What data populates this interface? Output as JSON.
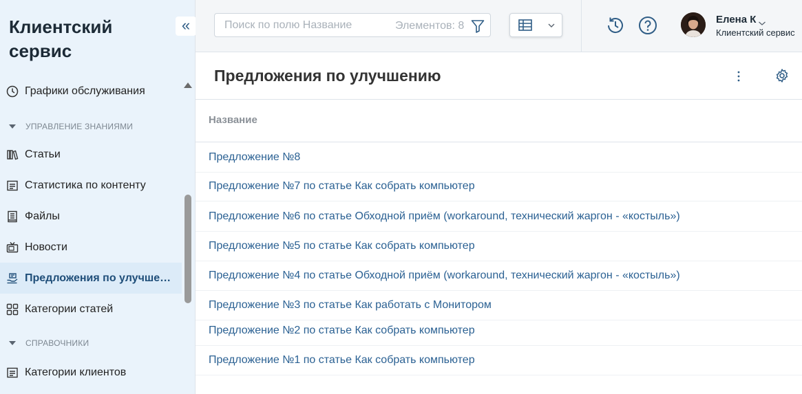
{
  "sidebar": {
    "app_title": "Клиентский сервис",
    "collapse_glyph": "«",
    "items": [
      {
        "label": "Графики обслуживания",
        "icon": "clock-icon"
      },
      {
        "label": "Статьи",
        "icon": "books-icon"
      },
      {
        "label": "Статистика по контенту",
        "icon": "list-icon"
      },
      {
        "label": "Файлы",
        "icon": "document-icon"
      },
      {
        "label": "Новости",
        "icon": "tv-icon"
      },
      {
        "label": "Предложения по улучшен...",
        "icon": "hand-icon",
        "active": true
      },
      {
        "label": "Категории статей",
        "icon": "grid-icon"
      },
      {
        "label": "Категории клиентов",
        "icon": "list-icon"
      }
    ],
    "sections": [
      {
        "label": "УПРАВЛЕНИЕ ЗНАНИЯМИ"
      },
      {
        "label": "СПРАВОЧНИКИ"
      }
    ]
  },
  "header": {
    "search_placeholder": "Поиск по полю Название",
    "search_count": "Элементов: 8",
    "user_name": "Елена К",
    "user_role": "Клиентский сервис"
  },
  "main": {
    "title": "Предложения по улучшению",
    "column_header": "Название",
    "rows": [
      "Предложение №8",
      "Предложение №7  по статье Как собрать компьютер",
      "Предложение №6 по статье Обходной приём (workaround, технический жаргон - «костыль»)",
      "Предложение №5  по статье Как собрать компьютер",
      "Предложение №4 по статье Обходной приём (workaround, технический жаргон - «костыль»)",
      "Предложение №3 по статье Как работать с Монитором",
      "Предложение №2 по статье Как собрать компьютер",
      "Предложение №1 по статье Как собрать компьютер"
    ]
  },
  "colors": {
    "sidebar_bg": "#eaf3fb",
    "active_item_bg": "#dcebf8",
    "link": "#2b6193",
    "icon_accent": "#2f5d86"
  }
}
